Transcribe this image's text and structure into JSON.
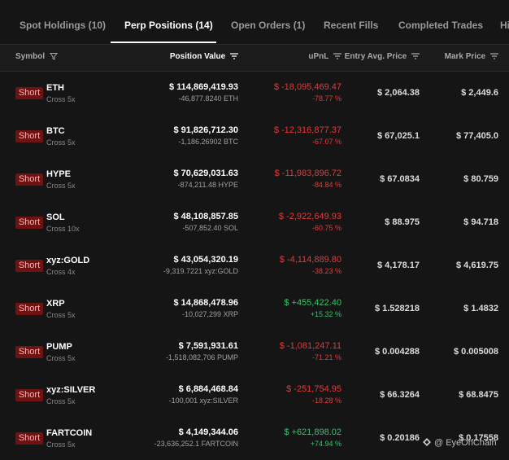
{
  "tabs": [
    {
      "label": "Spot Holdings (10)",
      "active": false
    },
    {
      "label": "Perp Positions (14)",
      "active": true
    },
    {
      "label": "Open Orders (1)",
      "active": false
    },
    {
      "label": "Recent Fills",
      "active": false
    },
    {
      "label": "Completed Trades",
      "active": false
    },
    {
      "label": "Hi",
      "active": false
    }
  ],
  "columns": {
    "symbol": "Symbol",
    "position_value": "Position Value",
    "upnl": "uPnL",
    "entry": "Entry Avg. Price",
    "mark": "Mark Price"
  },
  "icons": {
    "symbol_header": "filter-icon",
    "sort": "sort-lines-icon",
    "watermark": "eyeonchain-logo-icon"
  },
  "colors": {
    "negative": "#e23a3a",
    "positive": "#36c36a",
    "short_badge": "#6e1212"
  },
  "positions": [
    {
      "side": "Short",
      "symbol": "ETH",
      "leverage": "Cross 5x",
      "value": "$ 114,869,419.93",
      "qty": "-46,877.8240 ETH",
      "upnl": "$ -18,095,469.47",
      "upnl_pct": "-78.77 %",
      "sign": "neg",
      "entry": "$ 2,064.38",
      "mark": "$ 2,449.6"
    },
    {
      "side": "Short",
      "symbol": "BTC",
      "leverage": "Cross 5x",
      "value": "$ 91,826,712.30",
      "qty": "-1,186.26902 BTC",
      "upnl": "$ -12,316,877.37",
      "upnl_pct": "-67.07 %",
      "sign": "neg",
      "entry": "$ 67,025.1",
      "mark": "$ 77,405.0"
    },
    {
      "side": "Short",
      "symbol": "HYPE",
      "leverage": "Cross 5x",
      "value": "$ 70,629,031.63",
      "qty": "-874,211.48 HYPE",
      "upnl": "$ -11,983,896.72",
      "upnl_pct": "-84.84 %",
      "sign": "neg",
      "entry": "$ 67.0834",
      "mark": "$ 80.759"
    },
    {
      "side": "Short",
      "symbol": "SOL",
      "leverage": "Cross 10x",
      "value": "$ 48,108,857.85",
      "qty": "-507,852.40 SOL",
      "upnl": "$ -2,922,649.93",
      "upnl_pct": "-60.75 %",
      "sign": "neg",
      "entry": "$ 88.975",
      "mark": "$ 94.718"
    },
    {
      "side": "Short",
      "symbol": "xyz:GOLD",
      "leverage": "Cross 4x",
      "value": "$ 43,054,320.19",
      "qty": "-9,319.7221 xyz:GOLD",
      "upnl": "$ -4,114,889.80",
      "upnl_pct": "-38.23 %",
      "sign": "neg",
      "entry": "$ 4,178.17",
      "mark": "$ 4,619.75"
    },
    {
      "side": "Short",
      "symbol": "XRP",
      "leverage": "Cross 5x",
      "value": "$ 14,868,478.96",
      "qty": "-10,027,299 XRP",
      "upnl": "$ +455,422.40",
      "upnl_pct": "+15.32 %",
      "sign": "pos",
      "entry": "$ 1.528218",
      "mark": "$ 1.4832"
    },
    {
      "side": "Short",
      "symbol": "PUMP",
      "leverage": "Cross 5x",
      "value": "$ 7,591,931.61",
      "qty": "-1,518,082,706 PUMP",
      "upnl": "$ -1,081,247.11",
      "upnl_pct": "-71.21 %",
      "sign": "neg",
      "entry": "$ 0.004288",
      "mark": "$ 0.005008"
    },
    {
      "side": "Short",
      "symbol": "xyz:SILVER",
      "leverage": "Cross 5x",
      "value": "$ 6,884,468.84",
      "qty": "-100,001 xyz:SILVER",
      "upnl": "$ -251,754.95",
      "upnl_pct": "-18.28 %",
      "sign": "neg",
      "entry": "$ 66.3264",
      "mark": "$ 68.8475"
    },
    {
      "side": "Short",
      "symbol": "FARTCOIN",
      "leverage": "Cross 5x",
      "value": "$ 4,149,344.06",
      "qty": "-23,636,252.1 FARTCOIN",
      "upnl": "$ +621,898.02",
      "upnl_pct": "+74.94 %",
      "sign": "pos",
      "entry": "$ 0.20186",
      "mark": "$ 0.17558"
    }
  ],
  "watermark": "@ EyeOnChain"
}
